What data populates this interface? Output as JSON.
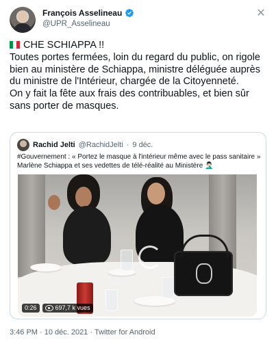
{
  "author": {
    "display_name": "François Asselineau",
    "handle": "@UPR_Asselineau"
  },
  "close_icon": "close-icon",
  "tweet": {
    "flag_colors": [
      "#009246",
      "#ffffff",
      "#ce2b37"
    ],
    "line1": "CHE SCHIAPPA !!",
    "paragraph1": "Toutes portes fermées, loin du regard du public, on rigole bien au ministère de Schiappa, ministre déléguée auprès du ministre de l'Intérieur, chargée de la Citoyenneté.",
    "paragraph2": "On y fait la fête aux frais des contribuables, et bien sûr sans porter de masques."
  },
  "quoted": {
    "display_name": "Rachid Jelti",
    "handle": "@RachidJelti",
    "separator": "·",
    "date": "9 déc.",
    "text_line1": "#Gouvernement : « Portez le masque à l'intérieur même avec le pass sanitaire »",
    "text_line2": "Marlène Schiappa et ses vedettes de télé-réalité au Ministère 🤦🏻‍♂️",
    "video": {
      "duration": "0:26",
      "views": "697,7 k vues"
    }
  },
  "footer": {
    "time": "3:46 PM",
    "separator1": " · ",
    "date": "10 déc. 2021",
    "separator2": " · ",
    "source": "Twitter for Android"
  },
  "colors": {
    "accent": "#1d9bf0",
    "secondary_text": "#536471",
    "border": "#cfd9de"
  }
}
